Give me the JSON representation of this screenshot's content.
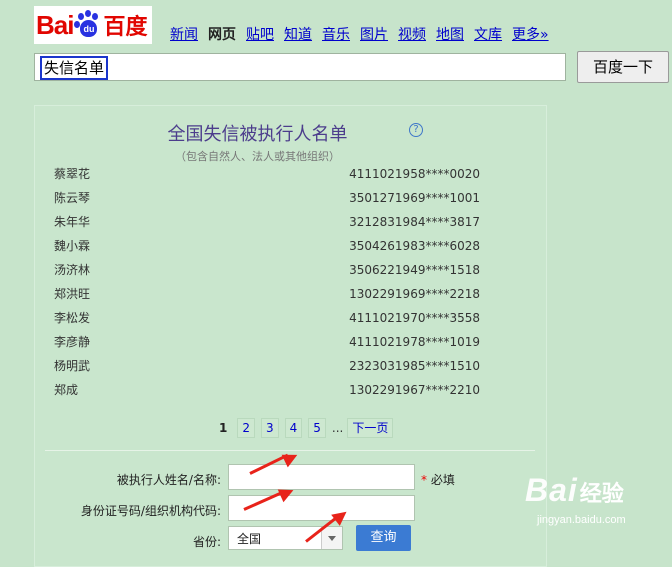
{
  "logo": {
    "bai": "Bai",
    "paw": "du",
    "baidu": "百度"
  },
  "nav": [
    "新闻",
    "网页",
    "贴吧",
    "知道",
    "音乐",
    "图片",
    "视频",
    "地图",
    "文库",
    "更多»"
  ],
  "search": {
    "query": "失信名单",
    "button": "百度一下"
  },
  "card": {
    "title": "全国失信被执行人名单",
    "help": "?",
    "subtitle": "（包含自然人、法人或其他组织）",
    "rows": [
      {
        "name": "蔡翠花",
        "id": "4111021958****0020"
      },
      {
        "name": "陈云琴",
        "id": "3501271969****1001"
      },
      {
        "name": "朱年华",
        "id": "3212831984****3817"
      },
      {
        "name": "魏小霖",
        "id": "3504261983****6028"
      },
      {
        "name": "汤济林",
        "id": "3506221949****1518"
      },
      {
        "name": "郑洪旺",
        "id": "1302291969****2218"
      },
      {
        "name": "李松发",
        "id": "4111021970****3558"
      },
      {
        "name": "李彦静",
        "id": "4111021978****1019"
      },
      {
        "name": "杨明武",
        "id": "2323031985****1510"
      },
      {
        "name": "郑成",
        "id": "1302291967****2210"
      }
    ],
    "pager": {
      "current": "1",
      "pages": [
        "2",
        "3",
        "4",
        "5"
      ],
      "ellipsis": "...",
      "next": "下一页"
    },
    "form": {
      "name_label": "被执行人姓名/名称:",
      "id_label": "身份证号码/组织机构代码:",
      "province_label": "省份:",
      "required_star": "*",
      "required": "必填",
      "province_value": "全国",
      "submit": "查询"
    }
  },
  "watermark": {
    "b1": "Bai",
    "b2": "经验",
    "url": "jingyan.baidu.com"
  },
  "colors": {
    "arrow": "#e8231a",
    "link": "#0000cc",
    "title": "#4c3d8c",
    "button": "#3b7bd3"
  }
}
